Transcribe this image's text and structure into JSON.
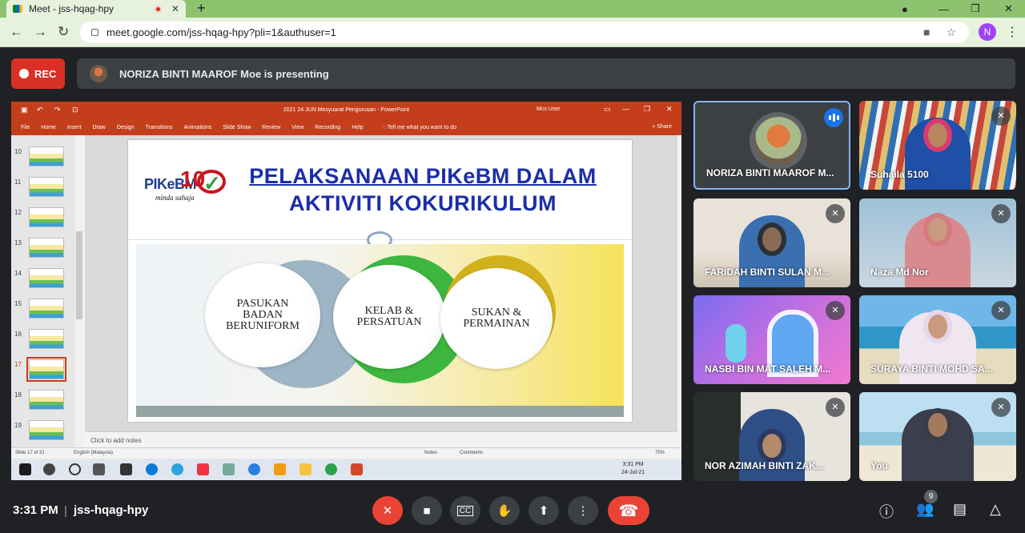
{
  "browser": {
    "tab_title": "Meet - jss-hqag-hpy",
    "new_tab": "+",
    "url": "meet.google.com/jss-hqag-hpy?pli=1&authuser=1",
    "profile_initial": "N"
  },
  "meet": {
    "rec_label": "REC",
    "presenting_text": "NORIZA BINTI MAAROF Moe is presenting",
    "time": "3:31 PM",
    "separator": "|",
    "meeting_code": "jss-hqag-hpy",
    "participant_count": "9"
  },
  "powerpoint": {
    "window_title": "2021 24 JUN Mesyuarat Pengurusan  -  PowerPoint",
    "user": "Mcs User",
    "ribbon_tabs": [
      "File",
      "Home",
      "Insert",
      "Draw",
      "Design",
      "Transitions",
      "Animations",
      "Slide Show",
      "Review",
      "View",
      "Recording",
      "Help"
    ],
    "tell_me": "Tell me what you want to do",
    "share": "Share",
    "thumb_numbers": [
      "10",
      "11",
      "12",
      "13",
      "14",
      "15",
      "16",
      "17",
      "18",
      "19"
    ],
    "selected_slide": "17",
    "notes_placeholder": "Click to add notes",
    "status_slide": "Slide 17 of 31",
    "status_lang": "English (Malaysia)",
    "status_notes": "Notes",
    "status_comments": "Comments",
    "zoom": "75%",
    "taskbar_time": "3:31 PM",
    "taskbar_date": "24-Jul-21"
  },
  "slide": {
    "logo_text": "PIKeBM",
    "logo_number": "10",
    "logo_tagline": "minda sahaja",
    "title_line1": "PELAKSANAAN PIKeBM DALAM",
    "title_line2": "AKTIVITI KOKURIKULUM",
    "circle1": "PASUKAN BADAN BERUNIFORM",
    "circle2": "KELAB & PERSATUAN",
    "circle3": "SUKAN & PERMAINAN"
  },
  "participants": [
    {
      "name": "NORIZA BINTI MAAROF M..."
    },
    {
      "name": "Suhaila 5100"
    },
    {
      "name": "FARIDAH BINTI SULAN M..."
    },
    {
      "name": "Naza Md Nor"
    },
    {
      "name": "NASBI BIN MAT SALEH M..."
    },
    {
      "name": "SURAYA BINTI MOHD SA..."
    },
    {
      "name": "NOR AZIMAH BINTI ZAK..."
    },
    {
      "name": "You"
    }
  ],
  "colors": {
    "rec": "#d93025",
    "meet_bg": "#202124",
    "ppt_accent": "#c43e1c",
    "slide_title": "#1b2ea8",
    "hangup": "#ea4335",
    "active_tile": "#8ab4f8"
  },
  "icons": {
    "back": "arrow-left-icon",
    "forward": "arrow-right-icon",
    "reload": "reload-icon",
    "mic_off": "mic-off-icon",
    "camera": "camera-icon",
    "captions": "captions-icon",
    "hand": "raise-hand-icon",
    "present": "present-icon",
    "more": "more-icon",
    "hangup": "hangup-icon",
    "info": "info-icon",
    "people": "people-icon",
    "chat": "chat-icon",
    "activities": "activities-icon"
  }
}
